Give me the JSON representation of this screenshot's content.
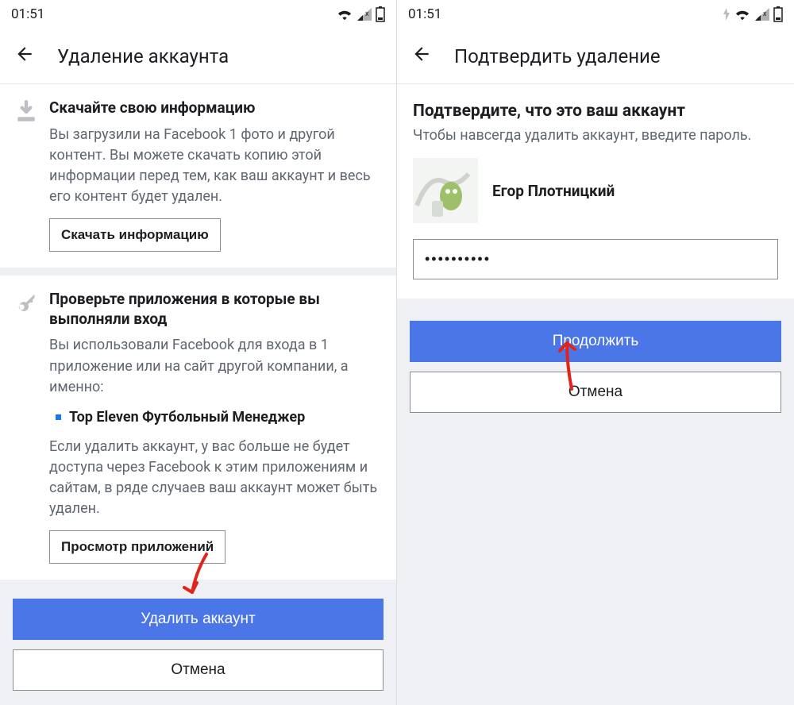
{
  "left": {
    "status_time": "01:51",
    "header_title": "Удаление аккаунта",
    "download": {
      "title": "Скачайте свою информацию",
      "text": "Вы загрузили на Facebook 1 фото и другой контент. Вы можете скачать копию этой информации перед тем, как ваш аккаунт и весь его контент будет удален.",
      "button": "Скачать информацию"
    },
    "apps": {
      "title": "Проверьте приложения в которые вы выполняли вход",
      "text": "Вы использовали Facebook для входа в 1 приложение или на сайт другой компании, а именно:",
      "bullet": "Top Eleven Футбольный Менеджер",
      "after": "Если удалить аккаунт, у вас больше не будет доступа через Facebook к этим приложениям и сайтам, в ряде случаев ваш аккаунт может быть удален.",
      "button": "Просмотр приложений"
    },
    "primary": "Удалить аккаунт",
    "secondary": "Отмена"
  },
  "right": {
    "status_time": "01:51",
    "header_title": "Подтвердить удаление",
    "confirm": {
      "title": "Подтвердите, что это ваш аккаунт",
      "text": "Чтобы навсегда удалить аккаунт, введите пароль.",
      "user_name": "Егор Плотницкий",
      "password_value": "••••••••••"
    },
    "primary": "Продолжить",
    "secondary": "Отмена"
  }
}
